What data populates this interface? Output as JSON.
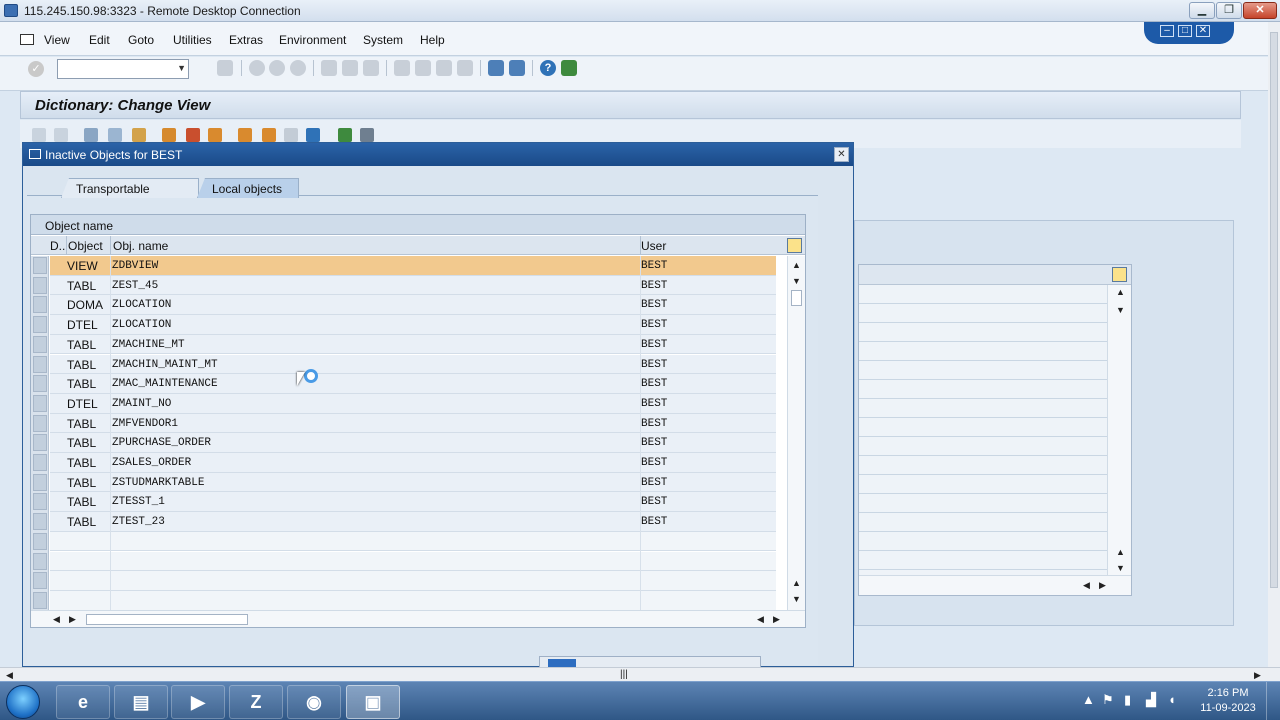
{
  "rdp": {
    "title": "115.245.150.98:3323 - Remote Desktop Connection"
  },
  "menu": [
    "View",
    "Edit",
    "Goto",
    "Utilities",
    "Extras",
    "Environment",
    "System",
    "Help"
  ],
  "screen": {
    "title": "Dictionary: Change View"
  },
  "dialog": {
    "title": "Inactive Objects for BEST",
    "tabs": [
      "Transportable Objects",
      "Local objects"
    ],
    "active_tab": "Local objects",
    "grid_title": "Object name",
    "columns": {
      "d": "D..",
      "object": "Object",
      "obj_name": "Obj. name",
      "user": "User"
    },
    "rows": [
      {
        "object": "VIEW",
        "name": "ZDBVIEW",
        "user": "BEST"
      },
      {
        "object": "TABL",
        "name": "ZEST_45",
        "user": "BEST"
      },
      {
        "object": "DOMA",
        "name": "ZLOCATION",
        "user": "BEST"
      },
      {
        "object": "DTEL",
        "name": "ZLOCATION",
        "user": "BEST"
      },
      {
        "object": "TABL",
        "name": "ZMACHINE_MT",
        "user": "BEST"
      },
      {
        "object": "TABL",
        "name": "ZMACHIN_MAINT_MT",
        "user": "BEST"
      },
      {
        "object": "TABL",
        "name": "ZMAC_MAINTENANCE",
        "user": "BEST"
      },
      {
        "object": "DTEL",
        "name": "ZMAINT_NO",
        "user": "BEST"
      },
      {
        "object": "TABL",
        "name": "ZMFVENDOR1",
        "user": "BEST"
      },
      {
        "object": "TABL",
        "name": "ZPURCHASE_ORDER",
        "user": "BEST"
      },
      {
        "object": "TABL",
        "name": "ZSALES_ORDER",
        "user": "BEST"
      },
      {
        "object": "TABL",
        "name": "ZSTUDMARKTABLE",
        "user": "BEST"
      },
      {
        "object": "TABL",
        "name": "ZTESST_1",
        "user": "BEST"
      },
      {
        "object": "TABL",
        "name": "ZTEST_23",
        "user": "BEST"
      }
    ]
  },
  "taskbar": {
    "time": "2:16 PM",
    "date": "11-09-2023"
  },
  "colors": {
    "selected_row": "#f2c98e",
    "sap_blue": "#1d5aa8"
  }
}
